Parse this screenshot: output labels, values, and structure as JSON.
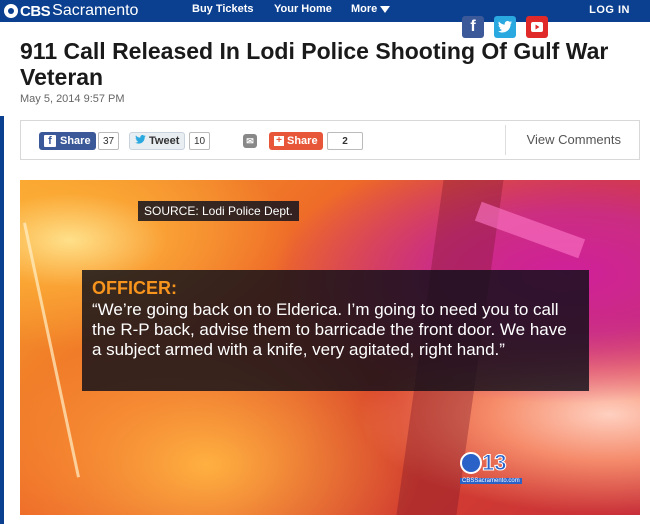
{
  "nav": {
    "logo_cbs": "CBS",
    "logo_city": "Sacramento",
    "links": [
      "Buy Tickets",
      "Your Home",
      "More"
    ],
    "login": "LOG IN"
  },
  "social": {
    "facebook": "f",
    "twitter": "t",
    "youtube": "▶"
  },
  "article": {
    "headline": "911 Call Released In Lodi Police Shooting Of Gulf War Veteran",
    "date": "May 5, 2014 9:57 PM"
  },
  "sharebar": {
    "fb_label": "Share",
    "fb_count": "37",
    "tw_label": "Tweet",
    "tw_count": "10",
    "mail_icon": "✉",
    "share_label": "Share",
    "share_count": "2",
    "view_comments": "View Comments"
  },
  "video": {
    "source": "SOURCE:  Lodi Police Dept.",
    "speaker": "OFFICER:",
    "quote": "“We’re going back on to Elderica. I’m going to need you to call the R-P back, advise them to barricade the front door. We have a subject armed with a knife, very agitated, right hand.”",
    "station_number": "13",
    "station_url": "CBSSacramento.com"
  },
  "colors": {
    "brand": "#0b3f8f",
    "accent_orange": "#f7941d"
  }
}
